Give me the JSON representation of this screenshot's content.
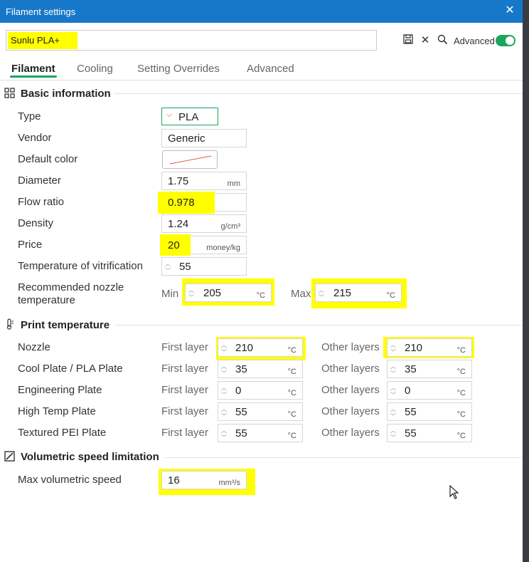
{
  "window": {
    "title": "Filament settings",
    "close_icon": "close-icon"
  },
  "preset": {
    "name": "Sunlu PLA+"
  },
  "toolbar": {
    "advanced_label": "Advanced",
    "advanced_on": true
  },
  "tabs": [
    {
      "label": "Filament",
      "active": true
    },
    {
      "label": "Cooling",
      "active": false
    },
    {
      "label": "Setting Overrides",
      "active": false
    },
    {
      "label": "Advanced",
      "active": false
    }
  ],
  "basic": {
    "title": "Basic information",
    "type_label": "Type",
    "type_value": "PLA",
    "vendor_label": "Vendor",
    "vendor_value": "Generic",
    "color_label": "Default color",
    "diameter_label": "Diameter",
    "diameter_value": "1.75",
    "diameter_unit": "mm",
    "flow_label": "Flow ratio",
    "flow_value": "0.978",
    "density_label": "Density",
    "density_value": "1.24",
    "density_unit": "g/cm³",
    "price_label": "Price",
    "price_value": "20",
    "price_unit": "money/kg",
    "vitri_label": "Temperature of vitrification",
    "vitri_value": "55",
    "nozzle_rec_label1": "Recommended nozzle",
    "nozzle_rec_label2": "temperature",
    "min_label": "Min",
    "min_value": "205",
    "max_label": "Max",
    "max_value": "215",
    "deg_unit": "°C"
  },
  "print_temp": {
    "title": "Print temperature",
    "first_layer": "First layer",
    "other_layers": "Other layers",
    "rows": [
      {
        "label": "Nozzle",
        "first": "210",
        "other": "210"
      },
      {
        "label": "Cool Plate / PLA Plate",
        "first": "35",
        "other": "35"
      },
      {
        "label": "Engineering Plate",
        "first": "0",
        "other": "0"
      },
      {
        "label": "High Temp Plate",
        "first": "55",
        "other": "55"
      },
      {
        "label": "Textured PEI Plate",
        "first": "55",
        "other": "55"
      }
    ],
    "unit": "°C"
  },
  "volumetric": {
    "title": "Volumetric speed limitation",
    "max_label": "Max volumetric speed",
    "max_value": "16",
    "unit": "mm³/s"
  },
  "colors": {
    "accent": "#1aa55e",
    "titlebar": "#1778c9",
    "highlight": "#ffff00"
  }
}
